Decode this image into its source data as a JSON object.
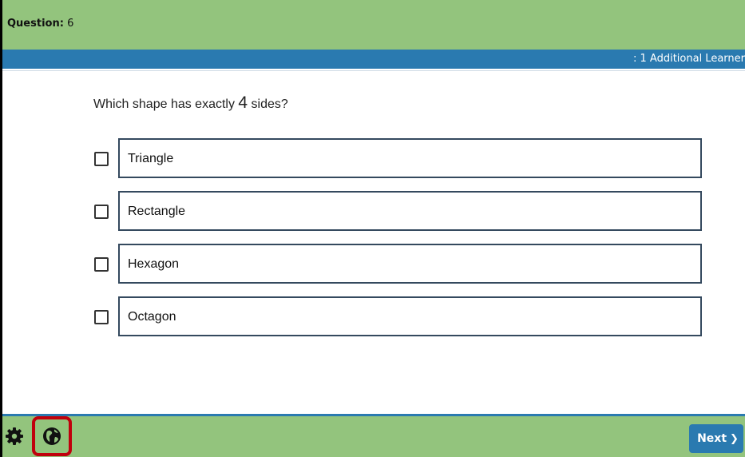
{
  "header": {
    "question_label": "Question:",
    "question_number": "6"
  },
  "banner": {
    "learner_text": ": 1 Additional Learner"
  },
  "question": {
    "prefix": "Which shape has exactly ",
    "number": "4",
    "suffix": " sides?"
  },
  "options": [
    {
      "label": "Triangle",
      "checked": false
    },
    {
      "label": "Rectangle",
      "checked": false
    },
    {
      "label": "Hexagon",
      "checked": false
    },
    {
      "label": "Octagon",
      "checked": false
    }
  ],
  "footer": {
    "next_label": "Next",
    "settings_icon": "gear-icon",
    "language_icon": "globe-icon",
    "highlight_color": "#c0000c"
  },
  "colors": {
    "header_green": "#93c47d",
    "accent_blue": "#2a7ab0",
    "option_border": "#34495e"
  }
}
